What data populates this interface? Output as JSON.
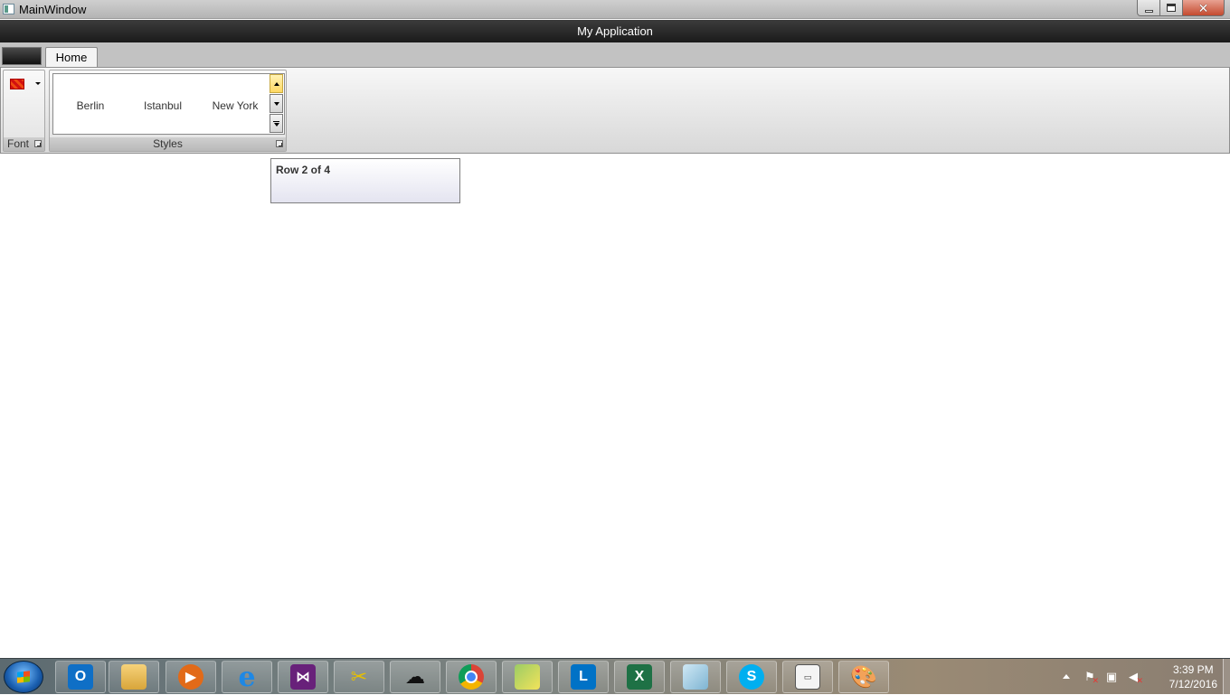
{
  "window": {
    "title": "MainWindow",
    "app_title": "My Application",
    "close_glyph": "✕"
  },
  "ribbon": {
    "tabs": [
      {
        "label": "Home"
      }
    ],
    "groups": {
      "font": {
        "label": "Font"
      },
      "styles": {
        "label": "Styles",
        "gallery_items": [
          "Berlin",
          "Istanbul",
          "New York"
        ]
      }
    }
  },
  "content": {
    "row_status": "Row 2 of 4"
  },
  "taskbar": {
    "apps": [
      {
        "name": "outlook",
        "glyph": "O"
      },
      {
        "name": "file-explorer",
        "glyph": ""
      },
      {
        "name": "media-player",
        "glyph": "▶"
      },
      {
        "name": "internet-explorer",
        "glyph": "e"
      },
      {
        "name": "visual-studio",
        "glyph": "⋈"
      },
      {
        "name": "tools",
        "glyph": "✂"
      },
      {
        "name": "blender",
        "glyph": "☁"
      },
      {
        "name": "chrome",
        "glyph": ""
      },
      {
        "name": "sticky",
        "glyph": ""
      },
      {
        "name": "lync",
        "glyph": "L"
      },
      {
        "name": "excel",
        "glyph": "X"
      },
      {
        "name": "paper",
        "glyph": ""
      },
      {
        "name": "skype",
        "glyph": "S"
      },
      {
        "name": "app-window",
        "glyph": "▭"
      },
      {
        "name": "paint",
        "glyph": "🎨"
      }
    ],
    "tray": {
      "flag_glyph": "⚑",
      "net_glyph": "▣",
      "vol_glyph": "◀"
    },
    "clock": {
      "time": "3:39 PM",
      "date": "7/12/2016"
    }
  }
}
